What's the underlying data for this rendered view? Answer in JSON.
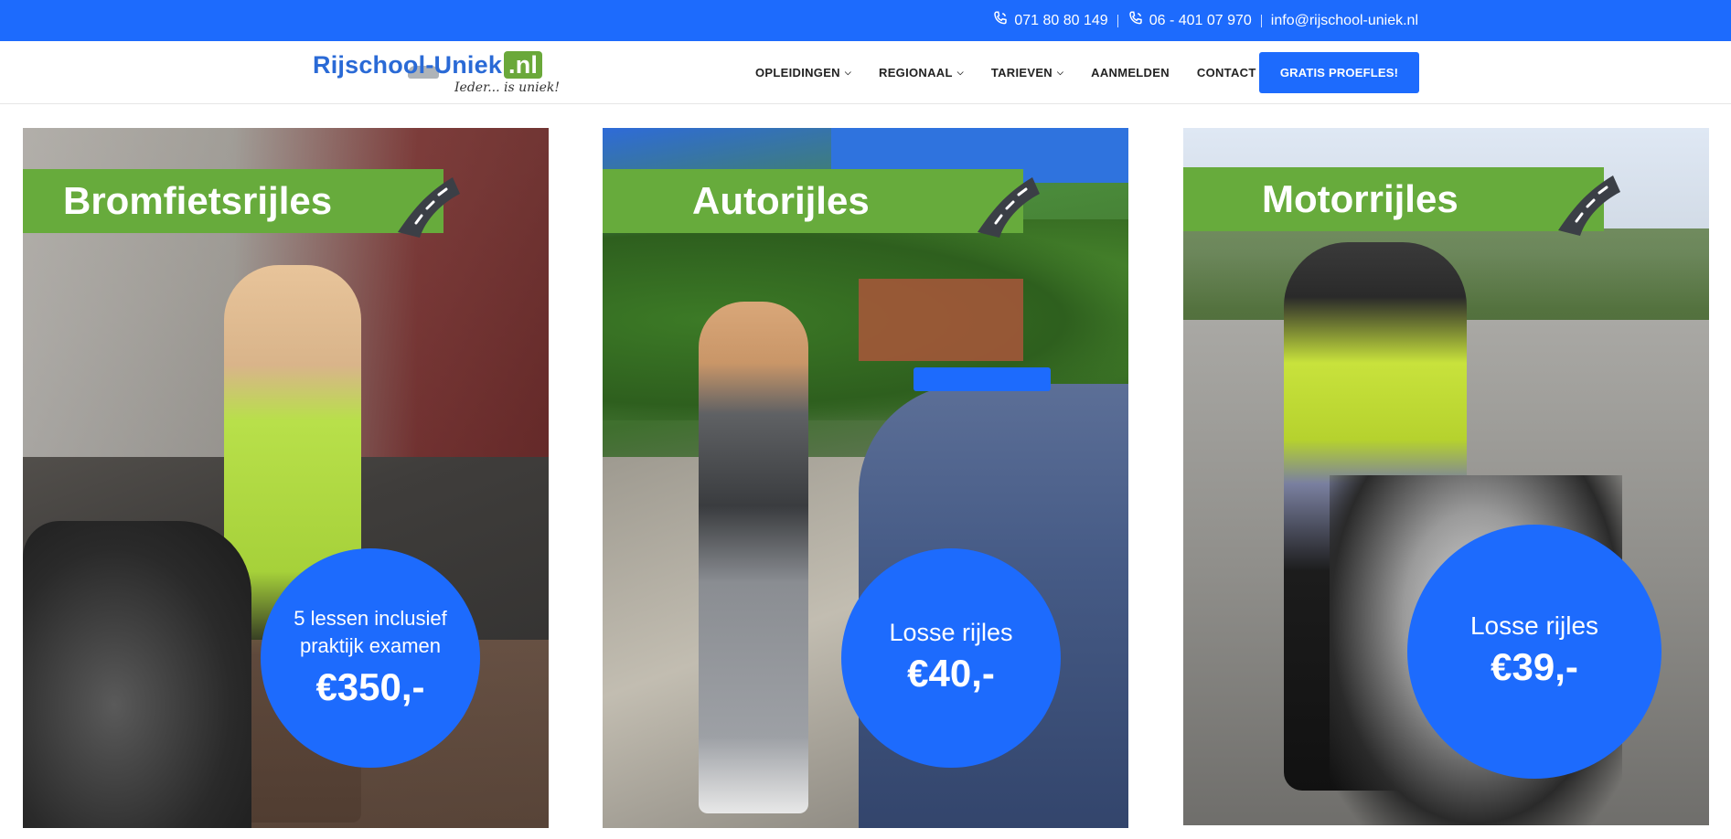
{
  "topbar": {
    "phone1": "071 80 80 149",
    "phone2": "06 - 401 07 970",
    "email": "info@rijschool-uniek.nl",
    "phone_icon": "phone-icon"
  },
  "header": {
    "logo_brand": "Rijschool-Uniek",
    "logo_tld": ".nl",
    "logo_tagline": "Ieder... is uniek!",
    "nav": [
      {
        "label": "OPLEIDINGEN",
        "has_dropdown": true
      },
      {
        "label": "REGIONAAL",
        "has_dropdown": true
      },
      {
        "label": "TARIEVEN",
        "has_dropdown": true
      },
      {
        "label": "AANMELDEN",
        "has_dropdown": false
      },
      {
        "label": "CONTACT",
        "has_dropdown": false
      }
    ],
    "cta_label": "GRATIS PROEFLES!"
  },
  "cards": [
    {
      "title": "Bromfietsrijles",
      "desc": "5 lessen inclusief praktijk examen",
      "price": "€350,-"
    },
    {
      "title": "Autorijles",
      "desc": "Losse rijles",
      "price": "€40,-"
    },
    {
      "title": "Motorrijles",
      "desc": "Losse rijles",
      "price": "€39,-"
    }
  ],
  "colors": {
    "primary_blue": "#1d6bfd",
    "banner_green": "#67ab3c",
    "road_gray": "#3b3f46"
  }
}
